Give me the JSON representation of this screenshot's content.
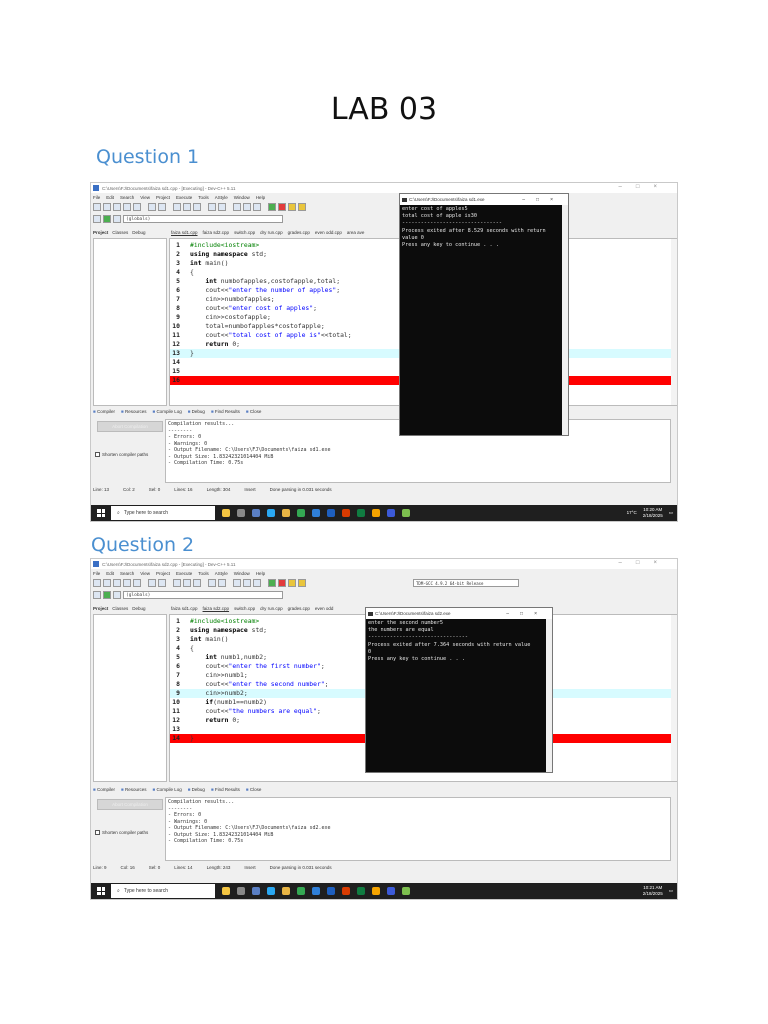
{
  "page_title": "LAB 03",
  "questions": [
    {
      "heading": "Question 1",
      "window_title": "C:\\Users\\FJ\\Documents\\faiza sd1.cpp - [Executing] - Dev-C++ 5.11",
      "menu": [
        "File",
        "Edit",
        "Search",
        "View",
        "Project",
        "Execute",
        "Tools",
        "AStyle",
        "Window",
        "Help"
      ],
      "scope": "(globals)",
      "left_tabs": [
        "Project",
        "Classes",
        "Debug"
      ],
      "file_tabs": [
        "faiza sd1.cpp",
        "faiza sd2.cpp",
        "switch.cpp",
        "dry run.cpp",
        "grades.cpp",
        "even odd.cpp",
        "area ave"
      ],
      "code": [
        {
          "n": "1",
          "t": "#include<iostream>"
        },
        {
          "n": "2",
          "t": "using namespace std;"
        },
        {
          "n": "3",
          "t": "int main()"
        },
        {
          "n": "4",
          "t": "{"
        },
        {
          "n": "5",
          "t": "    int numbofapples,costofapple,total;"
        },
        {
          "n": "6",
          "t": "    cout<<\"enter the number of apples\";"
        },
        {
          "n": "7",
          "t": "    cin>>numbofapples;"
        },
        {
          "n": "8",
          "t": "    cout<<\"enter cost of apples\";"
        },
        {
          "n": "9",
          "t": "    cin>>costofapple;"
        },
        {
          "n": "10",
          "t": "    total=numbofapples*costofapple;"
        },
        {
          "n": "11",
          "t": "    cout<<\"total cost of apple is\"<<total;"
        },
        {
          "n": "12",
          "t": "    return 0;"
        },
        {
          "n": "13",
          "t": "}"
        },
        {
          "n": "14",
          "t": ""
        },
        {
          "n": "15",
          "t": ""
        },
        {
          "n": "16",
          "t": ""
        }
      ],
      "bottom_tabs": [
        "Compiler",
        "Resources",
        "Compile Log",
        "Debug",
        "Find Results",
        "Close"
      ],
      "abort_label": "Abort Compilation",
      "shorten_label": "Shorten compiler paths",
      "log": "Compilation results...\n--------\n- Errors: 0\n- Warnings: 0\n- Output Filename: C:\\Users\\FJ\\Documents\\faiza sd1.exe\n- Output Size: 1.83242321014404 MiB\n- Compilation Time: 0.75s",
      "status": [
        "Line: 13",
        "Col: 2",
        "Sel: 0",
        "Lines: 16",
        "Length: 304",
        "Insert",
        "Done parsing in 0.031 seconds"
      ],
      "console_title": "C:\\Users\\FJ\\Documents\\faiza sd1.exe",
      "console": "enter cost of apples5\ntotal cost of apple is30\n--------------------------------\nProcess exited after 8.529 seconds with return\nvalue 0\nPress any key to continue . . .",
      "search_placeholder": "Type here to search",
      "weather": "17°C",
      "time": "10:20 AM",
      "date": "2/18/2025"
    },
    {
      "heading": "Question 2",
      "window_title": "C:\\Users\\FJ\\Documents\\faiza sd2.cpp - [Executing] - Dev-C++ 5.11",
      "menu": [
        "File",
        "Edit",
        "Search",
        "View",
        "Project",
        "Execute",
        "Tools",
        "AStyle",
        "Window",
        "Help"
      ],
      "scope": "(globals)",
      "compiler": "TDM-GCC 4.9.2 64-bit Release",
      "left_tabs": [
        "Project",
        "Classes",
        "Debug"
      ],
      "file_tabs": [
        "faiza sd1.cpp",
        "faiza sd2.cpp",
        "switch.cpp",
        "dry run.cpp",
        "grades.cpp",
        "even odd"
      ],
      "code": [
        {
          "n": "1",
          "t": "#include<iostream>"
        },
        {
          "n": "2",
          "t": "using namespace std;"
        },
        {
          "n": "3",
          "t": "int main()"
        },
        {
          "n": "4",
          "t": "{"
        },
        {
          "n": "5",
          "t": "    int numb1,numb2;"
        },
        {
          "n": "6",
          "t": "    cout<<\"enter the first number\";"
        },
        {
          "n": "7",
          "t": "    cin>>numb1;"
        },
        {
          "n": "8",
          "t": "    cout<<\"enter the second number\";"
        },
        {
          "n": "9",
          "t": "    cin>>numb2;"
        },
        {
          "n": "10",
          "t": "    if(numb1==numb2)"
        },
        {
          "n": "11",
          "t": "    cout<<\"the numbers are equal\";"
        },
        {
          "n": "12",
          "t": "    return 0;"
        },
        {
          "n": "13",
          "t": ""
        },
        {
          "n": "14",
          "t": "}"
        }
      ],
      "bottom_tabs": [
        "Compiler",
        "Resources",
        "Compile Log",
        "Debug",
        "Find Results",
        "Close"
      ],
      "abort_label": "Abort Compilation",
      "shorten_label": "Shorten compiler paths",
      "log": "Compilation results...\n--------\n- Errors: 0\n- Warnings: 0\n- Output Filename: C:\\Users\\FJ\\Documents\\faiza sd2.exe\n- Output Size: 1.83242321014404 MiB\n- Compilation Time: 0.75s",
      "status": [
        "Line: 9",
        "Col: 16",
        "Sel: 0",
        "Lines: 14",
        "Length: 243",
        "Insert",
        "Done parsing in 0.031 seconds"
      ],
      "console_title": "C:\\Users\\FJ\\Documents\\faiza sd2.exe",
      "console": "enter the second number5\nthe numbers are equal\n--------------------------------\nProcess exited after 7.364 seconds with return value\n0\nPress any key to continue . . .",
      "search_placeholder": "Type here to search",
      "time": "10:21 AM",
      "date": "2/18/2025"
    }
  ]
}
